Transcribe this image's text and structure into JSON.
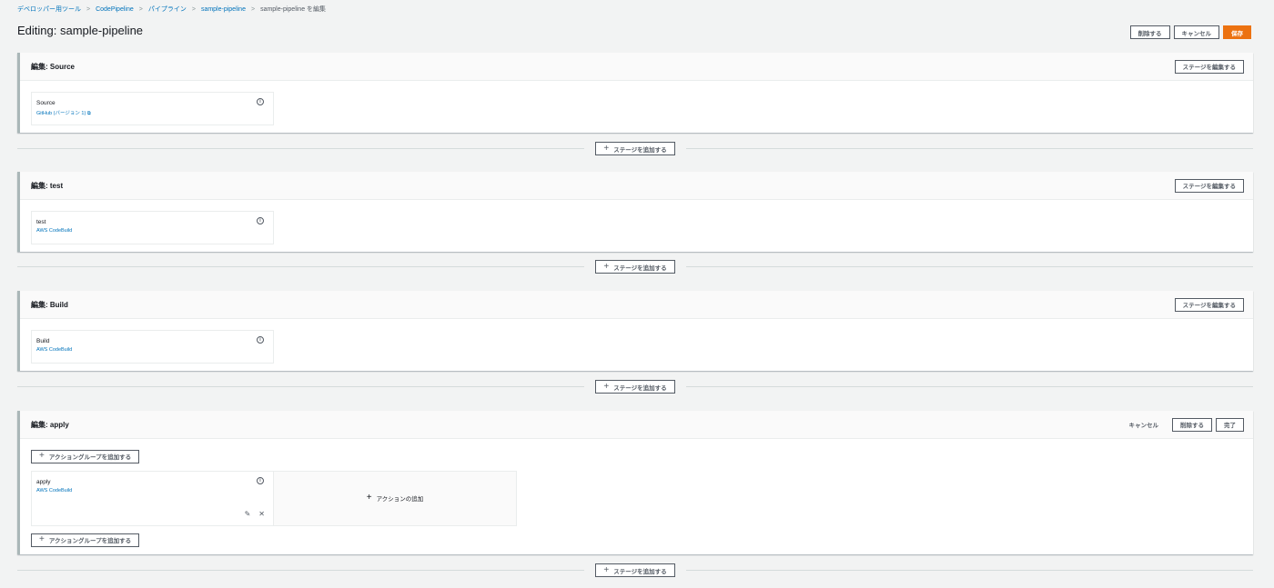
{
  "breadcrumb": {
    "items": [
      "デベロッパー用ツール",
      "CodePipeline",
      "パイプライン",
      "sample-pipeline"
    ],
    "current": "sample-pipeline を編集",
    "separator": ">"
  },
  "page": {
    "title": "Editing: sample-pipeline",
    "delete_label": "削除する",
    "cancel_label": "キャンセル",
    "save_label": "保存"
  },
  "icons": {
    "info": "info-icon",
    "plus": "plus-icon",
    "edit": "edit-icon",
    "close": "close-icon",
    "external": "external-link-icon"
  },
  "stages": [
    {
      "title": "編集: Source",
      "edit_label": "ステージを編集する",
      "action": {
        "name": "Source",
        "provider": "GitHub (バージョン 1)"
      }
    },
    {
      "title": "編集: test",
      "edit_label": "ステージを編集する",
      "action": {
        "name": "test",
        "provider": "AWS CodeBuild"
      }
    },
    {
      "title": "編集: Build",
      "edit_label": "ステージを編集する",
      "action": {
        "name": "Build",
        "provider": "AWS CodeBuild"
      }
    },
    {
      "title": "編集: apply",
      "cancel_label": "キャンセル",
      "delete_label": "削除する",
      "done_label": "完了",
      "add_group_label": "アクショングループを追加する",
      "action": {
        "name": "apply",
        "provider": "AWS CodeBuild"
      },
      "add_action_label": "アクションの追加"
    }
  ],
  "add_stage_label": "ステージを追加する",
  "colors": {
    "primary": "#ec7211",
    "link": "#0073bb",
    "background": "#f2f3f3"
  }
}
